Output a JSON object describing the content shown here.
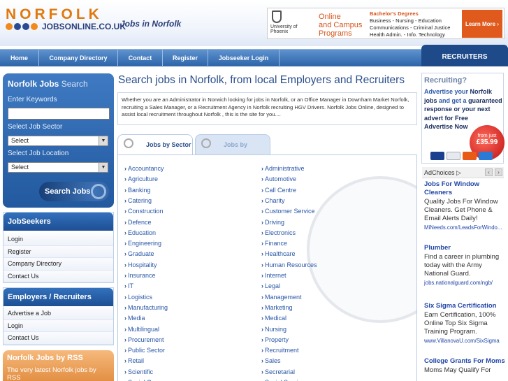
{
  "header": {
    "logo_word": "NORFOLK",
    "logo_sub": "JOBSONLINE.CO.UK",
    "logo_tag": "Jobs in Norfolk",
    "logo_dot_colors": [
      "#f08a1a",
      "#2a4a94",
      "#2a4a94",
      "#f08a1a"
    ]
  },
  "banner_ad": {
    "brand": "University of Phoenix",
    "headline_1": "Online",
    "headline_2": "and Campus",
    "headline_3": "Programs",
    "list_title": "Bachelor's Degrees",
    "list_1": "Business - Nursing - Education",
    "list_2": "Communications - Criminal Justice",
    "list_3": "Health Admin. - Info. Technology",
    "cta": "Learn More"
  },
  "nav": {
    "items": [
      "Home",
      "Company Directory",
      "Contact",
      "Register",
      "Jobseeker Login"
    ],
    "recruiters": "RECRUITERS"
  },
  "search": {
    "title_bold": "Norfolk Jobs",
    "title_light": "Search",
    "keywords_label": "Enter Keywords",
    "sector_label": "Select Job Sector",
    "sector_value": "Select",
    "location_label": "Select Job Location",
    "location_value": "Select",
    "button": "Search Jobs"
  },
  "jobseekers": {
    "title": "JobSeekers",
    "items": [
      "Login",
      "Register",
      "Company Directory",
      "Contact Us"
    ]
  },
  "employers": {
    "title": "Employers / Recruiters",
    "items": [
      "Advertise a Job",
      "Login",
      "Contact Us"
    ]
  },
  "rss": {
    "title": "Norfolk Jobs by RSS",
    "text": "The very latest Norfolk jobs by RSS"
  },
  "main": {
    "title": "Search jobs in Norfolk, from local Employers and Recruiters",
    "intro": "Whether you are an Administrator in Norwich looking for jobs in Norfolk, or an Office Manager in Downham Market Norfolk, recruiting a Sales Manager, or a Recruitment Agency in Norfolk recruiting HGV Drivers. Norfolk Jobs Online, designed to assist local recruitment throughout Norfolk , this is the site for you....",
    "tab_sector": "Jobs by Sector",
    "tab_location": "Jobs by Location",
    "sectors_left": [
      "Accountancy",
      "Agriculture",
      "Banking",
      "Catering",
      "Construction",
      "Defence",
      "Education",
      "Engineering",
      "Graduate",
      "Hospitality",
      "Insurance",
      "IT",
      "Logistics",
      "Manufacturing",
      "Media",
      "Multilingual",
      "Procurement",
      "Public Sector",
      "Retail",
      "Scientific",
      "Social Care"
    ],
    "sectors_right": [
      "Administrative",
      "Automotive",
      "Call Centre",
      "Charity",
      "Customer Service",
      "Driving",
      "Electronics",
      "Finance",
      "Healthcare",
      "Human Resources",
      "Internet",
      "Legal",
      "Management",
      "Marketing",
      "Medical",
      "Nursing",
      "Property",
      "Recruitment",
      "Sales",
      "Secretarial",
      "Social Services"
    ]
  },
  "recruit": {
    "heading": "Recruiting?",
    "line_1": "Advertise your",
    "line_1b": "Norfolk jobs",
    "line_2": "and get a",
    "line_2b": "guaranteed",
    "line_3": "response or your next advert for Free",
    "line_4": "Advertise Now",
    "badge_top": "from just",
    "badge_price": "£35.99"
  },
  "ads": {
    "adchoices": "AdChoices",
    "entries": [
      {
        "title": "Jobs For Window Cleaners",
        "desc": "Quality Jobs For Window Cleaners. Get Phone & Email Alerts Daily!",
        "url": "MiNeeds.com/LeadsForWindo..."
      },
      {
        "title": "Plumber",
        "desc": "Find a career in plumbing today with the Army National Guard.",
        "url": "jobs.nationalguard.com/ngb/"
      },
      {
        "title": "Six Sigma Certification",
        "desc": "Earn Certification, 100% Online Top Six Sigma Training Program.",
        "url": "www.VillanovaU.com/SixSigma"
      },
      {
        "title": "College Grants For Moms",
        "desc": "Moms May Qualify For",
        "url": ""
      }
    ]
  }
}
